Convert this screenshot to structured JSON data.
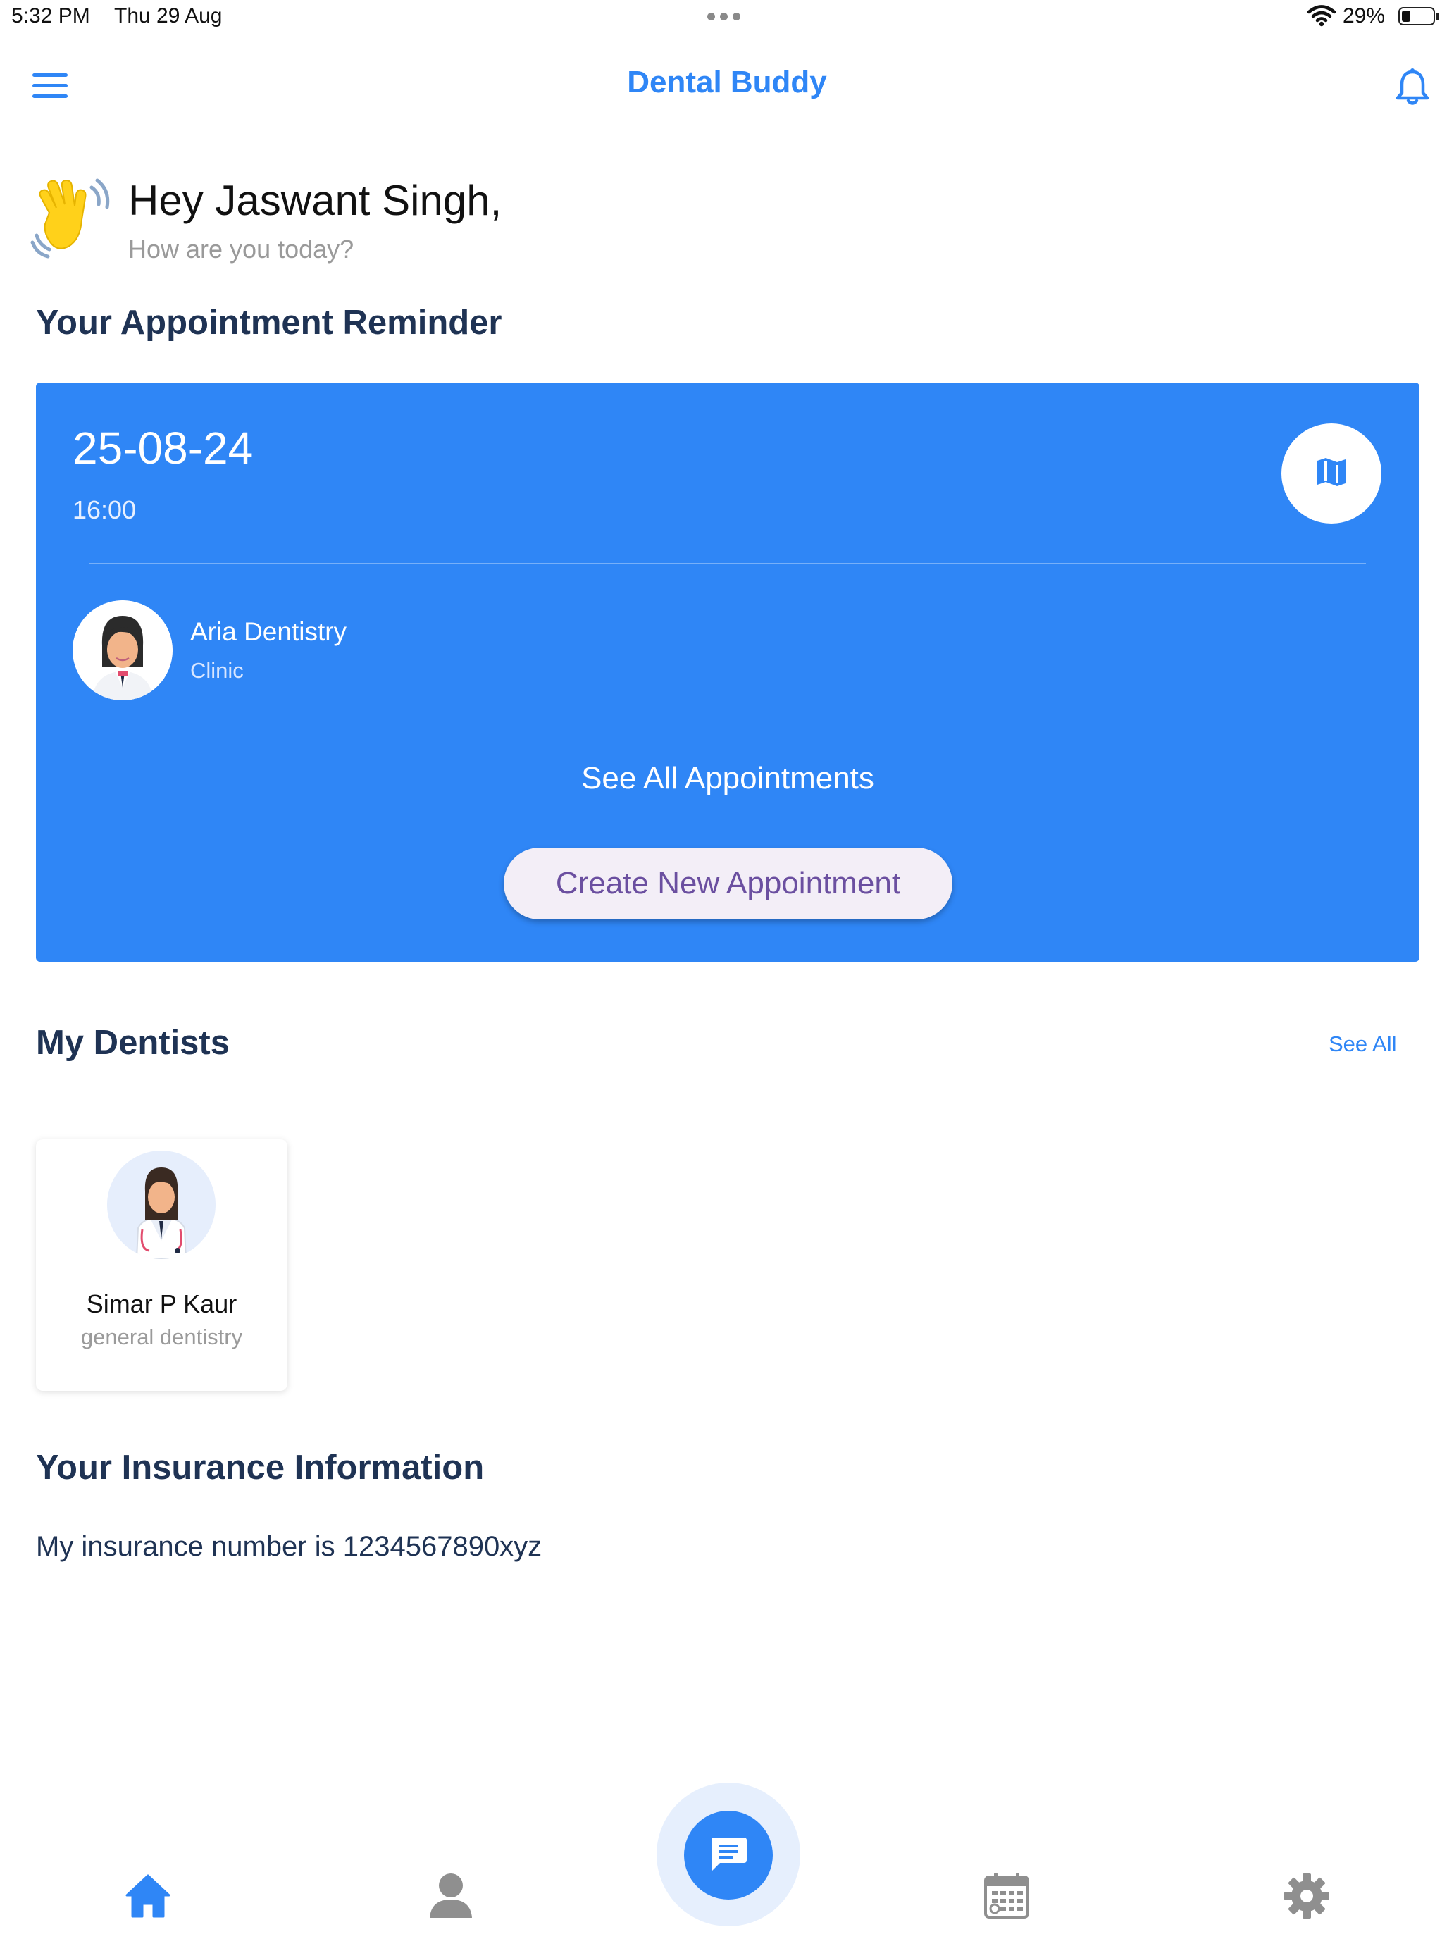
{
  "status_bar": {
    "time": "5:32 PM",
    "date": "Thu 29 Aug",
    "battery_percent": "29%",
    "battery_level": 0.29,
    "icons": [
      "more-dots-icon",
      "wifi-icon",
      "battery-icon"
    ]
  },
  "header": {
    "title": "Dental Buddy",
    "icons": [
      "menu-icon",
      "bell-icon"
    ]
  },
  "greeting": {
    "title": "Hey Jaswant Singh,",
    "subtitle": "How are you today?",
    "icon": "waving-hand-icon"
  },
  "appointment_section": {
    "title": "Your Appointment Reminder",
    "card": {
      "date": "25-08-24",
      "time": "16:00",
      "clinic_name": "Aria Dentistry",
      "clinic_type": "Clinic",
      "see_all_label": "See All Appointments",
      "create_label": "Create New Appointment",
      "map_icon": "map-icon"
    }
  },
  "dentists_section": {
    "title": "My Dentists",
    "see_all_label": "See All",
    "dentists": [
      {
        "name": "Simar P Kaur",
        "specialty": "general dentistry"
      }
    ]
  },
  "insurance_section": {
    "title": "Your Insurance Information",
    "text": "My insurance number is 1234567890xyz"
  },
  "bottom_nav": {
    "items": [
      "home-icon",
      "profile-icon",
      "chat-icon",
      "calendar-icon",
      "settings-icon"
    ],
    "active": "home-icon"
  },
  "colors": {
    "accent": "#2f86f6",
    "heading": "#1f3354",
    "inactive_icon": "#8f8f8f",
    "button_bg": "#f3eef7",
    "button_text": "#6b4fa0"
  }
}
